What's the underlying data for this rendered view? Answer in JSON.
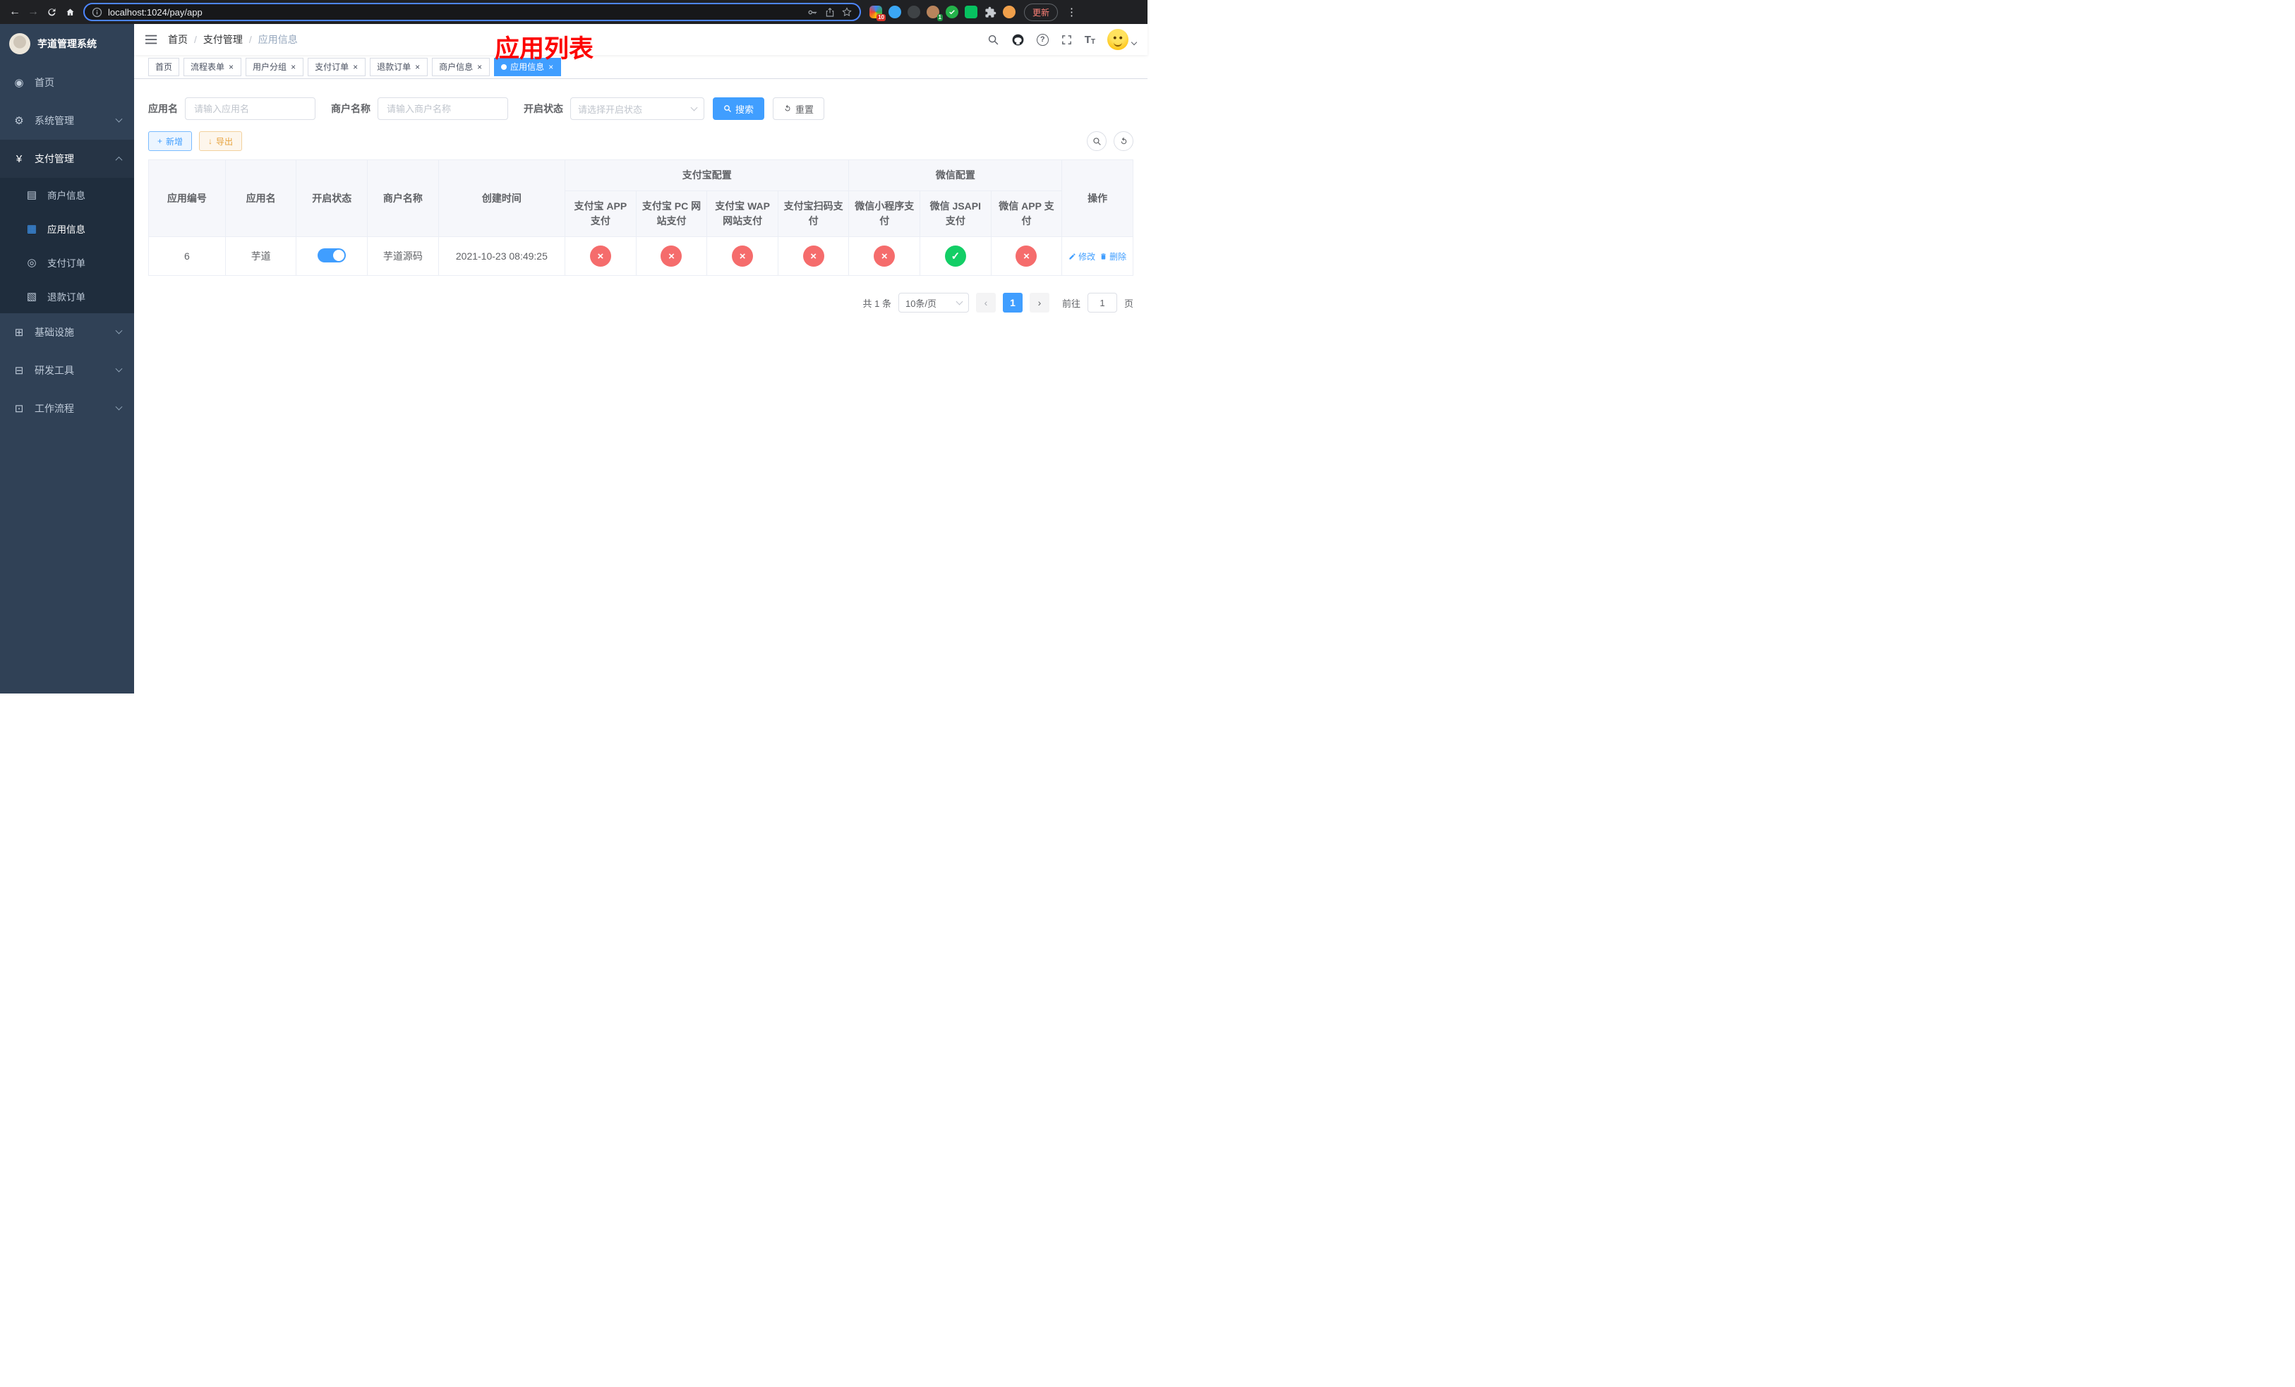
{
  "browser": {
    "url": "localhost:1024/pay/app",
    "update_label": "更新",
    "badge_ext": "10",
    "badge_avatar": "1"
  },
  "annotation": "应用列表",
  "sidebar": {
    "title": "芋道管理系统",
    "items": [
      {
        "label": "首页"
      },
      {
        "label": "系统管理"
      },
      {
        "label": "支付管理"
      },
      {
        "label": "商户信息"
      },
      {
        "label": "应用信息"
      },
      {
        "label": "支付订单"
      },
      {
        "label": "退款订单"
      },
      {
        "label": "基础设施"
      },
      {
        "label": "研发工具"
      },
      {
        "label": "工作流程"
      }
    ]
  },
  "breadcrumb": [
    "首页",
    "支付管理",
    "应用信息"
  ],
  "tabs": [
    {
      "label": "首页"
    },
    {
      "label": "流程表单"
    },
    {
      "label": "用户分组"
    },
    {
      "label": "支付订单"
    },
    {
      "label": "退款订单"
    },
    {
      "label": "商户信息"
    },
    {
      "label": "应用信息"
    }
  ],
  "filters": {
    "app_name_label": "应用名",
    "app_name_placeholder": "请输入应用名",
    "merchant_label": "商户名称",
    "merchant_placeholder": "请输入商户名称",
    "status_label": "开启状态",
    "status_placeholder": "请选择开启状态",
    "search_label": "搜索",
    "reset_label": "重置"
  },
  "toolbar": {
    "add_label": "新增",
    "export_label": "导出"
  },
  "table": {
    "groups": {
      "alipay": "支付宝配置",
      "wechat": "微信配置"
    },
    "columns": [
      "应用编号",
      "应用名",
      "开启状态",
      "商户名称",
      "创建时间",
      "支付宝 APP 支付",
      "支付宝 PC 网站支付",
      "支付宝 WAP 网站支付",
      "支付宝扫码支付",
      "微信小程序支付",
      "微信 JSAPI 支付",
      "微信 APP 支付",
      "操作"
    ],
    "rows": [
      {
        "id": "6",
        "name": "芋道",
        "status_on": true,
        "merchant": "芋道源码",
        "created": "2021-10-23 08:49:25",
        "channels": [
          false,
          false,
          false,
          false,
          false,
          true,
          false
        ],
        "edit_label": "修改",
        "delete_label": "删除"
      }
    ]
  },
  "pagination": {
    "total": "共 1 条",
    "size": "10条/页",
    "current": "1",
    "goto_label": "前往",
    "goto_value": "1",
    "page_label": "页"
  },
  "icons": {
    "back": "←",
    "forward": "→",
    "dots": "⋮",
    "close": "×",
    "check": "✓",
    "cross": "×",
    "plus": "+",
    "download": "↓",
    "help": "?",
    "font_large": "T",
    "font_small": "T",
    "prev": "‹",
    "next": "›",
    "dashboard": "◉",
    "gear": "⚙",
    "yen": "¥",
    "merchant": "▤",
    "appgrid": "▦",
    "order": "◎",
    "refund": "▧",
    "infra": "⊞",
    "tools": "⊟",
    "workflow": "⊡"
  }
}
